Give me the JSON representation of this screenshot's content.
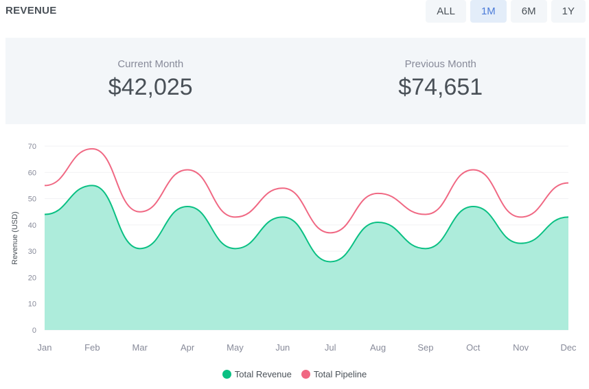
{
  "header": {
    "title": "REVENUE"
  },
  "filters": [
    {
      "label": "ALL",
      "active": false
    },
    {
      "label": "1M",
      "active": true
    },
    {
      "label": "6M",
      "active": false
    },
    {
      "label": "1Y",
      "active": false
    }
  ],
  "stats": {
    "current": {
      "label": "Current Month",
      "value": "$42,025"
    },
    "previous": {
      "label": "Previous Month",
      "value": "$74,651"
    }
  },
  "colors": {
    "revenue": "#0ac083",
    "revenue_fill": "#a9ebd9",
    "pipeline": "#f06883"
  },
  "chart_data": {
    "type": "area",
    "categories": [
      "Jan",
      "Feb",
      "Mar",
      "Apr",
      "May",
      "Jun",
      "Jul",
      "Aug",
      "Sep",
      "Oct",
      "Nov",
      "Dec"
    ],
    "series": [
      {
        "name": "Total Revenue",
        "values": [
          44,
          55,
          31,
          47,
          31,
          43,
          26,
          41,
          31,
          47,
          33,
          43
        ],
        "style": "area"
      },
      {
        "name": "Total Pipeline",
        "values": [
          55,
          69,
          45,
          61,
          43,
          54,
          37,
          52,
          44,
          61,
          43,
          56
        ],
        "style": "line"
      }
    ],
    "ylabel": "Revenue (USD)",
    "xlabel": "",
    "ylim": [
      0,
      70
    ],
    "yticks": [
      0,
      10,
      20,
      30,
      40,
      50,
      60,
      70
    ],
    "grid": true,
    "legend": "bottom-center"
  }
}
